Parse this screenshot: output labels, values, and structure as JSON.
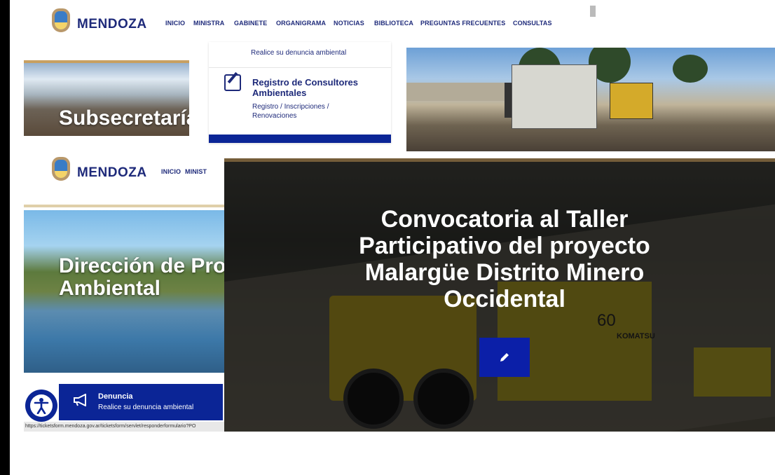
{
  "site": {
    "brand": "MENDOZA",
    "nav": [
      "INICIO",
      "MINISTRA",
      "GABINETE",
      "ORGANIGRAMA",
      "NOTICIAS",
      "BIBLIOTECA",
      "PREGUNTAS FRECUENTES",
      "CONSULTAS"
    ],
    "nav2_visible": [
      "INICIO",
      "MINIST"
    ]
  },
  "panel1": {
    "hero_title": "Subsecretaría",
    "menu_line": "Realice su denuncia ambiental",
    "menu_heading": "Registro de Consultores Ambientales",
    "menu_sub": "Registro / Inscripciones / Renovaciones"
  },
  "panel2": {
    "hero_title_line1": "Dirección de Pro",
    "hero_title_line2": "Ambiental",
    "denuncia_title": "Denuncia",
    "denuncia_sub": "Realice su denuncia ambiental",
    "status_url": "https://ticketsform.mendoza.gov.ar/ticketsform/servlet/responderformulario?PO"
  },
  "hero": {
    "title": "Convocatoria al Taller Participativo del proyecto Malargüe Distrito Minero Occidental",
    "machine_label": "KOMATSU",
    "machine_number": "60"
  },
  "colors": {
    "brand_blue": "#0b2596",
    "nav_text": "#1e2a7a",
    "gold_accent": "#c8a062"
  },
  "icons": [
    "edit-icon",
    "pencil-icon",
    "megaphone-icon",
    "accessibility-icon",
    "shield-logo-icon"
  ]
}
